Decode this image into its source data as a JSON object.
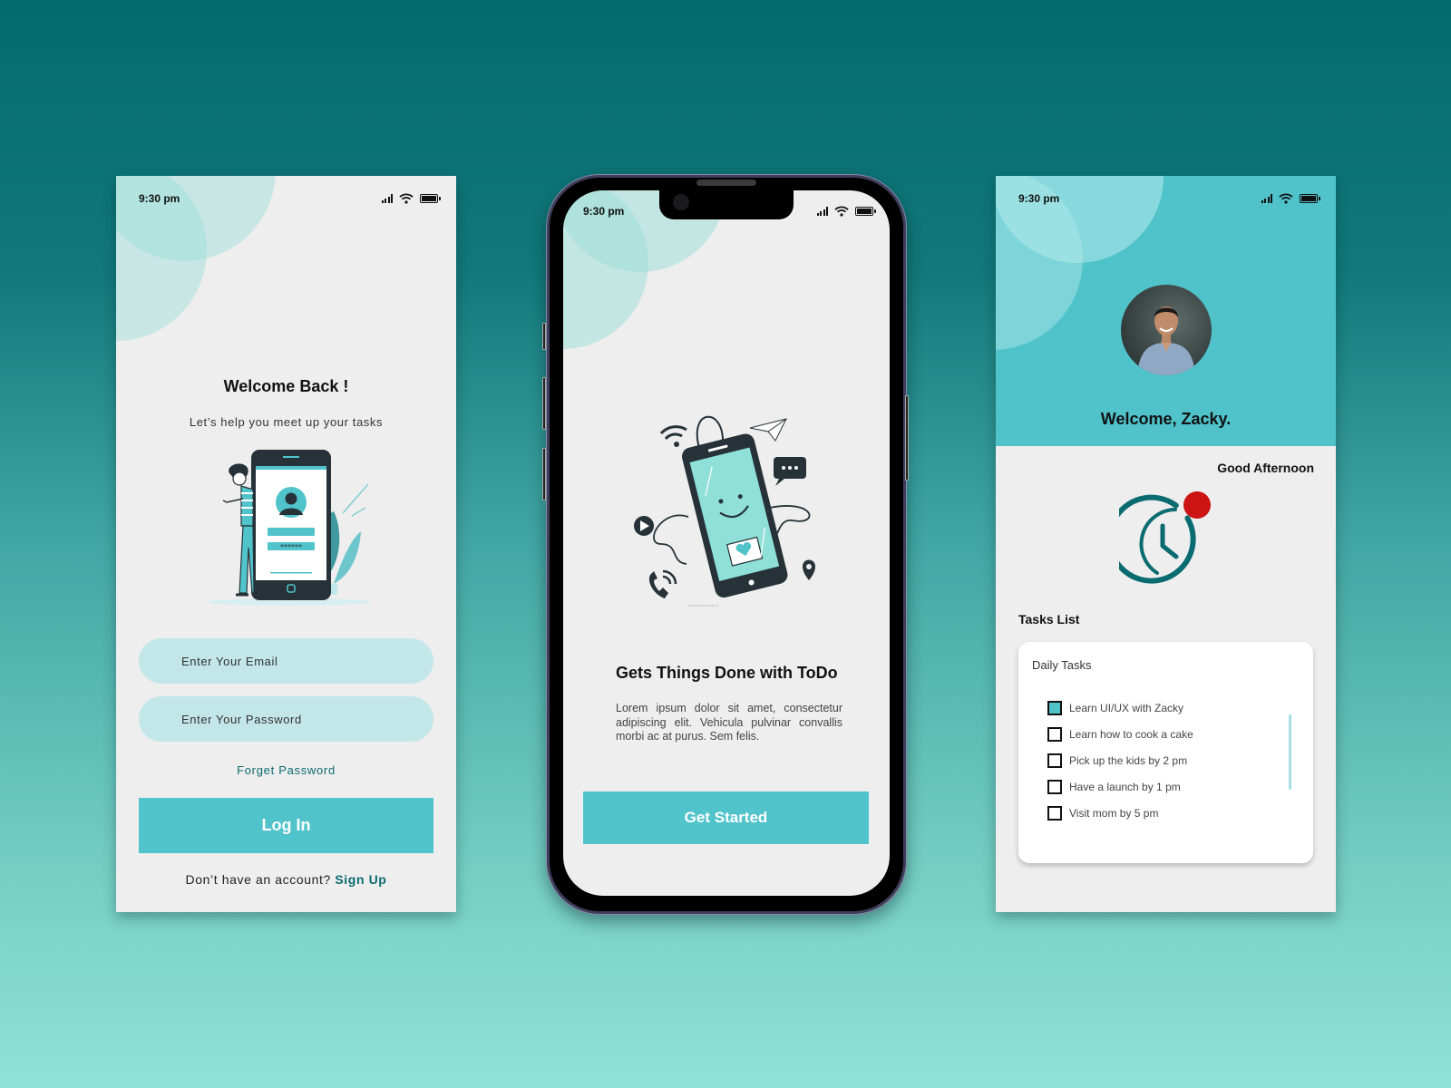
{
  "colors": {
    "accent": "#51c3cb",
    "accent_dark": "#0a6b70",
    "input_bg": "#c3e6e8",
    "screen_bg": "#eeeeee",
    "notification": "#cc1414",
    "clock": "#0a6b70"
  },
  "status_bar": {
    "time": "9:30 pm",
    "icons": [
      "signal-icon",
      "wifi-icon",
      "battery-icon"
    ]
  },
  "login": {
    "title": "Welcome Back !",
    "subtitle": "Let’s help you meet up your tasks",
    "illustration": "man-with-phone-login-illustration",
    "email_placeholder": "Enter Your Email",
    "password_placeholder": "Enter Your Password",
    "forget_password": "Forget Password",
    "login_button": "Log In",
    "signup_prompt": "Don’t have an account?",
    "signup_link": "Sign Up",
    "illustration_mask": "******"
  },
  "onboarding": {
    "illustration": "smiling-phone-illustration",
    "title": "Gets Things Done with ToDo",
    "body": "Lorem ipsum dolor sit amet, consectetur adipiscing elit. Vehicula pulvinar convallis morbi ac at purus. Sem felis.",
    "button": "Get Started"
  },
  "dashboard": {
    "welcome": "Welcome, Zacky.",
    "greeting": "Good Afternoon",
    "tasks_list_label": "Tasks List",
    "card_title": "Daily Tasks",
    "tasks": [
      {
        "label": "Learn UI/UX with Zacky",
        "checked": true
      },
      {
        "label": "Learn how to cook a cake",
        "checked": false
      },
      {
        "label": "Pick up the kids by 2 pm",
        "checked": false
      },
      {
        "label": "Have a launch by 1 pm",
        "checked": false
      },
      {
        "label": "Visit mom by 5 pm",
        "checked": false
      }
    ]
  }
}
